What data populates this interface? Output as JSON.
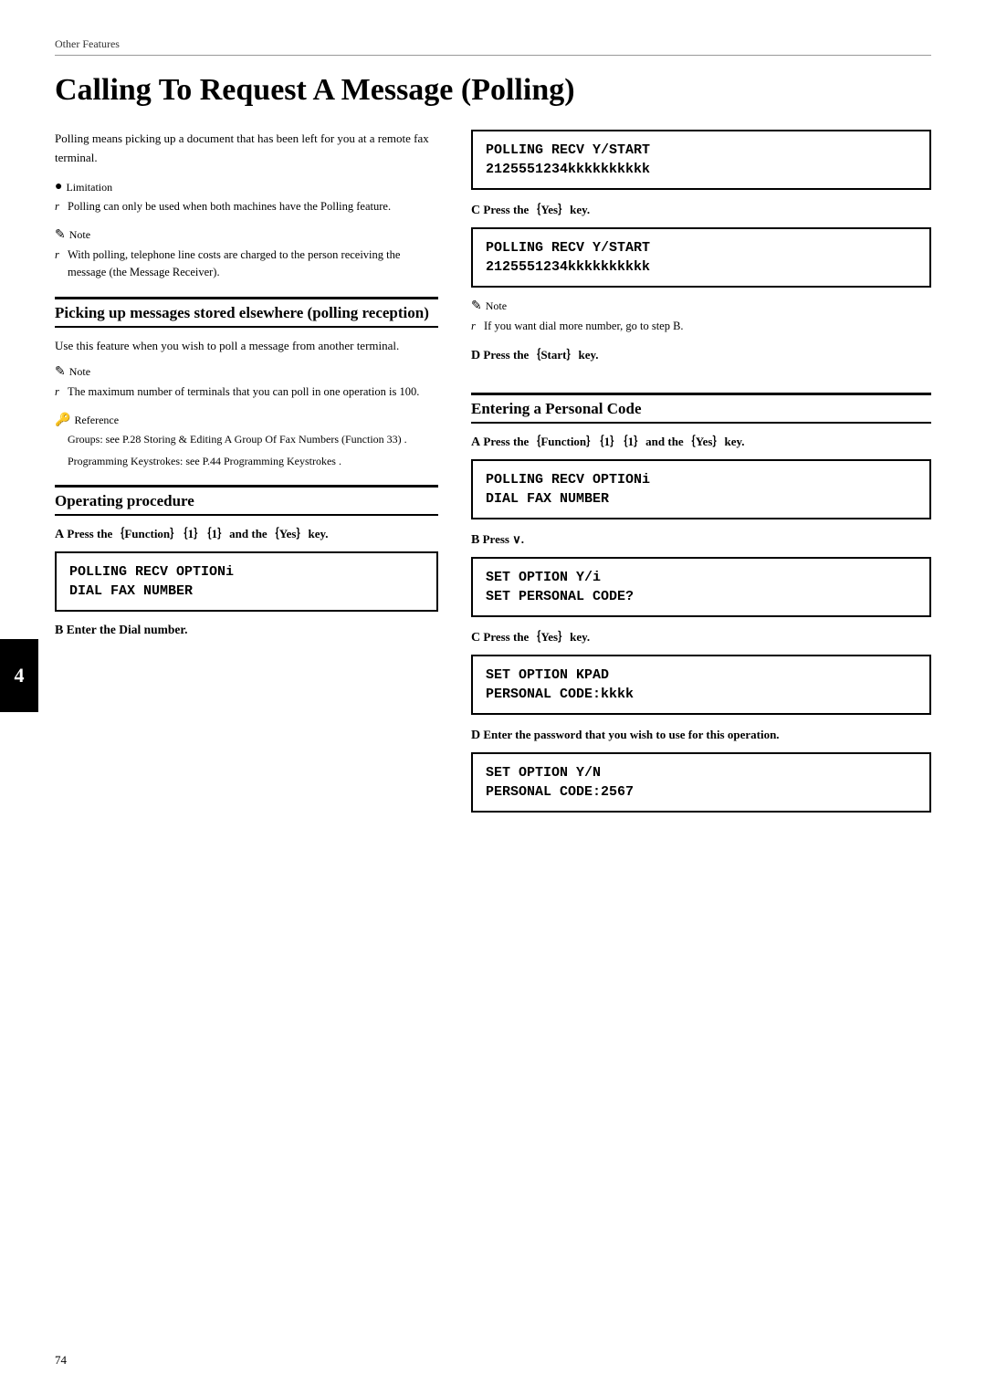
{
  "header": {
    "text": "Other Features",
    "rule": true
  },
  "title": "Calling To Request A Message (Polling)",
  "left_col": {
    "intro": "Polling means  picking up  a document that has been left for you at a remote fax terminal.",
    "limitation": {
      "label": "Limitation",
      "item": "Polling can only be used when both machines have the Polling feature."
    },
    "note1": {
      "label": "Note",
      "item": "With polling, telephone line costs are charged to the person receiving the message (the Message Receiver)."
    },
    "section1": {
      "heading": "Picking up messages stored elsewhere (polling reception)",
      "intro": "Use this feature when you wish to poll a message from another terminal.",
      "note": {
        "label": "Note",
        "item": "The maximum number of terminals that you can poll in one operation is 100."
      },
      "reference": {
        "label": "Reference",
        "items": [
          "Groups: see P.28   Storing & Editing A Group Of Fax Numbers (Function 33) .",
          "Programming Keystrokes: see P.44  Programming Keystrokes ."
        ]
      }
    },
    "section2": {
      "heading": "Operating procedure",
      "step_a": {
        "prefix": "A",
        "text": "Press the｛Function｝｛1｝｛1｝and the｛Yes｝key."
      },
      "lcd1": {
        "line1": "POLLING RECV OPTIONi",
        "line2": "DIAL FAX NUMBER"
      },
      "step_b": {
        "prefix": "B",
        "text": "Enter the Dial number."
      }
    }
  },
  "right_col": {
    "lcd_top1": {
      "line1": "POLLING RECV Y/START",
      "line2": "2125551234kkkkkkkkkk"
    },
    "step_c1": {
      "prefix": "C",
      "text": "Press the｛Yes｝key."
    },
    "lcd_top2": {
      "line1": "POLLING RECV Y/START",
      "line2": "2125551234kkkkkkkkkk"
    },
    "note_right": {
      "label": "Note",
      "item": "If you want dial more number, go to step B."
    },
    "step_d": {
      "prefix": "D",
      "text": "Press the｛Start｝key."
    },
    "entering_section": {
      "heading": "Entering a Personal Code",
      "step_a": {
        "prefix": "A",
        "text": "Press the｛Function｝｛1｝｛1｝and the｛Yes｝key."
      },
      "lcd1": {
        "line1": "POLLING RECV OPTIONi",
        "line2": "DIAL FAX NUMBER"
      },
      "step_b": {
        "prefix": "B",
        "text": "Press ∨."
      },
      "lcd2": {
        "line1": "SET OPTION      Y/i",
        "line2": "SET PERSONAL CODE?"
      },
      "step_c": {
        "prefix": "C",
        "text": "Press the｛Yes｝key."
      },
      "lcd3": {
        "line1": "SET OPTION      KPAD",
        "line2": "PERSONAL CODE:kkkk"
      },
      "step_d": {
        "prefix": "D",
        "text": "Enter the password that you wish to use for this operation."
      },
      "lcd4": {
        "line1": "SET OPTION      Y/N",
        "line2": "PERSONAL CODE:2567"
      }
    }
  },
  "chapter_number": "4",
  "page_number": "74"
}
